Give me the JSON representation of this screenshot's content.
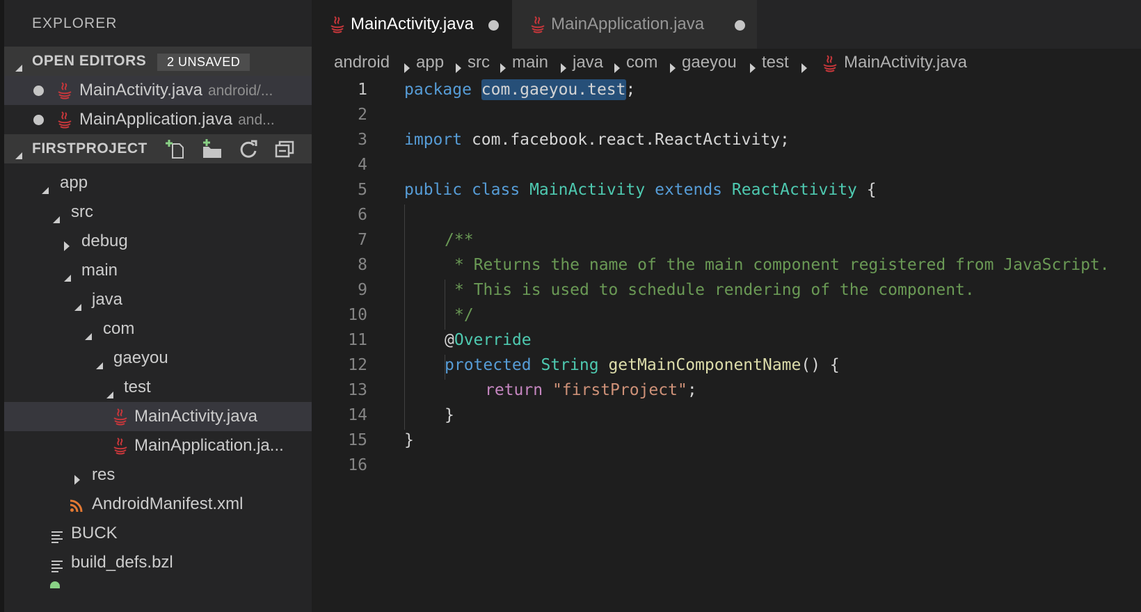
{
  "sidebar": {
    "title": "EXPLORER",
    "open_editors": {
      "header": "OPEN EDITORS",
      "badge": "2 UNSAVED",
      "items": [
        {
          "name": "MainActivity.java",
          "desc": "android/..."
        },
        {
          "name": "MainApplication.java",
          "desc": "and..."
        }
      ]
    },
    "project": {
      "header": "FIRSTPROJECT",
      "actions": [
        "new-file-icon",
        "new-folder-icon",
        "refresh-icon",
        "collapse-all-icon"
      ],
      "tree": [
        {
          "label": "app",
          "icon": "chevron-down-icon"
        },
        {
          "label": "src",
          "icon": "chevron-down-icon"
        },
        {
          "label": "debug",
          "icon": "chevron-right-icon"
        },
        {
          "label": "main",
          "icon": "chevron-down-icon"
        },
        {
          "label": "java",
          "icon": "chevron-down-icon"
        },
        {
          "label": "com",
          "icon": "chevron-down-icon"
        },
        {
          "label": "gaeyou",
          "icon": "chevron-down-icon"
        },
        {
          "label": "test",
          "icon": "chevron-down-icon"
        },
        {
          "label": "MainActivity.java",
          "icon": "java-file-icon"
        },
        {
          "label": "MainApplication.ja...",
          "icon": "java-file-icon"
        },
        {
          "label": "res",
          "icon": "chevron-right-icon"
        },
        {
          "label": "AndroidManifest.xml",
          "icon": "rss-xml-icon"
        },
        {
          "label": "BUCK",
          "icon": "text-file-icon"
        },
        {
          "label": "build_defs.bzl",
          "icon": "text-file-icon"
        }
      ]
    }
  },
  "tabs": [
    {
      "label": "MainActivity.java",
      "active": true,
      "unsaved": true
    },
    {
      "label": "MainApplication.java",
      "active": false,
      "unsaved": true
    }
  ],
  "breadcrumb": [
    "android",
    "app",
    "src",
    "main",
    "java",
    "com",
    "gaeyou",
    "test",
    "MainActivity.java"
  ],
  "code": {
    "line_numbers": [
      "1",
      "2",
      "3",
      "4",
      "5",
      "6",
      "7",
      "8",
      "9",
      "10",
      "11",
      "12",
      "13",
      "14",
      "15",
      "16"
    ],
    "l1_package": "package",
    "l1_name": "com.gaeyou.test",
    "l1_semi": ";",
    "l3_import": "import",
    "l3_name": " com.facebook.react.ReactActivity;",
    "l5_public": "public",
    "l5_class": "class",
    "l5_name": "MainActivity",
    "l5_extends": "extends",
    "l5_super": "ReactActivity",
    "l5_brace": " {",
    "l7": "/**",
    "l8": "* Returns the name of the main component registered from JavaScript.",
    "l9": "* This is used to schedule rendering of the component.",
    "l10": "*/",
    "l11_at": "@",
    "l11_ann": "Override",
    "l12_protected": "protected",
    "l12_type": "String",
    "l12_fn": "getMainComponentName",
    "l12_rest": "() {",
    "l13_return": "return",
    "l13_str": "\"firstProject\"",
    "l13_semi": ";",
    "l14": "}",
    "l15": "}"
  },
  "colors": {
    "java_icon": "#c8373b",
    "xml_icon": "#e37933",
    "add_icon": "#89d185"
  }
}
